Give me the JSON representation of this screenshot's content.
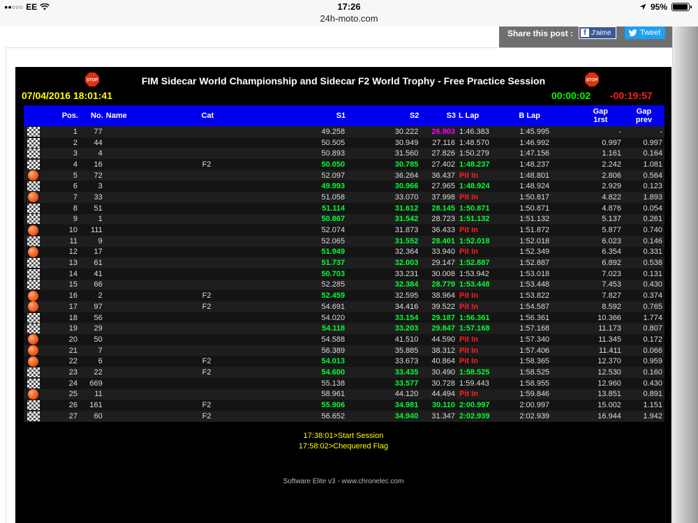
{
  "statusbar": {
    "carrier": "EE",
    "signal": "●●○○○",
    "time": "17:26",
    "url": "24h-moto.com",
    "battery": "95%",
    "battery_level": 0.95
  },
  "share": {
    "label": "Share this post :",
    "fb_label": "J'aime",
    "tw_label": "Tweet"
  },
  "board": {
    "title": "FIM Sidecar World Championship and Sidecar F2 World Trophy - Free Practice Session",
    "datetime": "07/04/2016 18:01:41",
    "elapsed": "00:00:02",
    "remaining": "-00:19:57",
    "headers": {
      "pos": "Pos.",
      "no": "No.",
      "name": "Name",
      "cat": "Cat",
      "s1": "S1",
      "s2": "S2",
      "s3": "S3",
      "llap": "L Lap",
      "blap": "B Lap",
      "gap1": "Gap",
      "gap1b": "1rst",
      "gap2": "Gap",
      "gap2b": "prev"
    },
    "rows": [
      {
        "status": "flag",
        "pos": "1",
        "no": "77",
        "name": "",
        "cat": "",
        "s1": "49.258",
        "s1c": "",
        "s2": "30.222",
        "s2c": "",
        "s3": "26.903",
        "s3c": "magenta",
        "llap": "1:46.383",
        "llapc": "",
        "blap": "1:45.995",
        "gap1": "-",
        "gap2": "-"
      },
      {
        "status": "flag",
        "pos": "2",
        "no": "44",
        "name": "",
        "cat": "",
        "s1": "50.505",
        "s1c": "",
        "s2": "30.949",
        "s2c": "",
        "s3": "27.116",
        "s3c": "",
        "llap": "1:48.570",
        "llapc": "",
        "blap": "1:46.992",
        "gap1": "0.997",
        "gap2": "0.997"
      },
      {
        "status": "flag",
        "pos": "3",
        "no": "4",
        "name": "",
        "cat": "",
        "s1": "50.893",
        "s1c": "",
        "s2": "31.560",
        "s2c": "",
        "s3": "27.826",
        "s3c": "",
        "llap": "1:50.279",
        "llapc": "",
        "blap": "1:47.156",
        "gap1": "1.161",
        "gap2": "0.164"
      },
      {
        "status": "flag",
        "pos": "4",
        "no": "16",
        "name": "",
        "cat": "F2",
        "s1": "50.050",
        "s1c": "green",
        "s2": "30.785",
        "s2c": "green",
        "s3": "27.402",
        "s3c": "",
        "llap": "1:48.237",
        "llapc": "green",
        "blap": "1:48.237",
        "gap1": "2.242",
        "gap2": "1.081"
      },
      {
        "status": "ball",
        "pos": "5",
        "no": "72",
        "name": "",
        "cat": "",
        "s1": "52.097",
        "s1c": "",
        "s2": "36.264",
        "s2c": "",
        "s3": "36.437",
        "s3c": "",
        "llap": "Pit In",
        "llapc": "pitin",
        "blap": "1:48.801",
        "gap1": "2.806",
        "gap2": "0.564"
      },
      {
        "status": "flag",
        "pos": "6",
        "no": "3",
        "name": "",
        "cat": "",
        "s1": "49.993",
        "s1c": "green",
        "s2": "30.966",
        "s2c": "green",
        "s3": "27.965",
        "s3c": "",
        "llap": "1:48.924",
        "llapc": "green",
        "blap": "1:48.924",
        "gap1": "2.929",
        "gap2": "0.123"
      },
      {
        "status": "ball",
        "pos": "7",
        "no": "33",
        "name": "",
        "cat": "",
        "s1": "51.058",
        "s1c": "",
        "s2": "33.070",
        "s2c": "",
        "s3": "37.998",
        "s3c": "",
        "llap": "Pit In",
        "llapc": "pitin",
        "blap": "1:50.817",
        "gap1": "4.822",
        "gap2": "1.893"
      },
      {
        "status": "flag",
        "pos": "8",
        "no": "51",
        "name": "",
        "cat": "",
        "s1": "51.114",
        "s1c": "green",
        "s2": "31.612",
        "s2c": "green",
        "s3": "28.145",
        "s3c": "green",
        "llap": "1:50.871",
        "llapc": "green",
        "blap": "1:50.871",
        "gap1": "4.876",
        "gap2": "0.054"
      },
      {
        "status": "flag",
        "pos": "9",
        "no": "1",
        "name": "",
        "cat": "",
        "s1": "50.867",
        "s1c": "green",
        "s2": "31.542",
        "s2c": "green",
        "s3": "28.723",
        "s3c": "",
        "llap": "1:51.132",
        "llapc": "green",
        "blap": "1:51.132",
        "gap1": "5.137",
        "gap2": "0.261"
      },
      {
        "status": "ball",
        "pos": "10",
        "no": "111",
        "name": "",
        "cat": "",
        "s1": "52.074",
        "s1c": "",
        "s2": "31.873",
        "s2c": "",
        "s3": "36.433",
        "s3c": "",
        "llap": "Pit In",
        "llapc": "pitin",
        "blap": "1:51.872",
        "gap1": "5.877",
        "gap2": "0.740"
      },
      {
        "status": "flag",
        "pos": "11",
        "no": "9",
        "name": "",
        "cat": "",
        "s1": "52.065",
        "s1c": "",
        "s2": "31.552",
        "s2c": "green",
        "s3": "28.401",
        "s3c": "green",
        "llap": "1:52.018",
        "llapc": "green",
        "blap": "1:52.018",
        "gap1": "6.023",
        "gap2": "0.146"
      },
      {
        "status": "ball",
        "pos": "12",
        "no": "17",
        "name": "",
        "cat": "",
        "s1": "51.949",
        "s1c": "green",
        "s2": "32.364",
        "s2c": "",
        "s3": "33.940",
        "s3c": "",
        "llap": "Pit In",
        "llapc": "pitin",
        "blap": "1:52.349",
        "gap1": "6.354",
        "gap2": "0.331"
      },
      {
        "status": "flag",
        "pos": "13",
        "no": "61",
        "name": "",
        "cat": "",
        "s1": "51.737",
        "s1c": "green",
        "s2": "32.003",
        "s2c": "green",
        "s3": "29.147",
        "s3c": "",
        "llap": "1:52.887",
        "llapc": "green",
        "blap": "1:52.887",
        "gap1": "6.892",
        "gap2": "0.538"
      },
      {
        "status": "flag",
        "pos": "14",
        "no": "41",
        "name": "",
        "cat": "",
        "s1": "50.703",
        "s1c": "green",
        "s2": "33.231",
        "s2c": "",
        "s3": "30.008",
        "s3c": "",
        "llap": "1:53.942",
        "llapc": "",
        "blap": "1:53.018",
        "gap1": "7.023",
        "gap2": "0.131"
      },
      {
        "status": "flag",
        "pos": "15",
        "no": "66",
        "name": "",
        "cat": "",
        "s1": "52.285",
        "s1c": "",
        "s2": "32.384",
        "s2c": "green",
        "s3": "28.779",
        "s3c": "green",
        "llap": "1:53.448",
        "llapc": "green",
        "blap": "1:53.448",
        "gap1": "7.453",
        "gap2": "0.430"
      },
      {
        "status": "ball",
        "pos": "16",
        "no": "2",
        "name": "",
        "cat": "F2",
        "s1": "52.459",
        "s1c": "green",
        "s2": "32.595",
        "s2c": "",
        "s3": "38.964",
        "s3c": "",
        "llap": "Pit In",
        "llapc": "pitin",
        "blap": "1:53.822",
        "gap1": "7.827",
        "gap2": "0.374"
      },
      {
        "status": "ball",
        "pos": "17",
        "no": "97",
        "name": "",
        "cat": "F2",
        "s1": "54.691",
        "s1c": "",
        "s2": "34.416",
        "s2c": "",
        "s3": "39.522",
        "s3c": "",
        "llap": "Pit In",
        "llapc": "pitin",
        "blap": "1:54.587",
        "gap1": "8.592",
        "gap2": "0.765"
      },
      {
        "status": "flag",
        "pos": "18",
        "no": "56",
        "name": "",
        "cat": "",
        "s1": "54.020",
        "s1c": "",
        "s2": "33.154",
        "s2c": "green",
        "s3": "29.187",
        "s3c": "green",
        "llap": "1:56.361",
        "llapc": "green",
        "blap": "1:56.361",
        "gap1": "10.366",
        "gap2": "1.774"
      },
      {
        "status": "flag",
        "pos": "19",
        "no": "29",
        "name": "",
        "cat": "",
        "s1": "54.118",
        "s1c": "green",
        "s2": "33.203",
        "s2c": "green",
        "s3": "29.847",
        "s3c": "green",
        "llap": "1:57.168",
        "llapc": "green",
        "blap": "1:57.168",
        "gap1": "11.173",
        "gap2": "0.807"
      },
      {
        "status": "ball",
        "pos": "20",
        "no": "50",
        "name": "",
        "cat": "",
        "s1": "54.588",
        "s1c": "",
        "s2": "41.510",
        "s2c": "",
        "s3": "44.590",
        "s3c": "",
        "llap": "Pit In",
        "llapc": "pitin",
        "blap": "1:57.340",
        "gap1": "11.345",
        "gap2": "0.172"
      },
      {
        "status": "ball",
        "pos": "21",
        "no": "7",
        "name": "",
        "cat": "",
        "s1": "56.389",
        "s1c": "",
        "s2": "35.885",
        "s2c": "",
        "s3": "38.312",
        "s3c": "",
        "llap": "Pit In",
        "llapc": "pitin",
        "blap": "1:57.406",
        "gap1": "11.411",
        "gap2": "0.066"
      },
      {
        "status": "ball",
        "pos": "22",
        "no": "6",
        "name": "",
        "cat": "F2",
        "s1": "54.013",
        "s1c": "green",
        "s2": "33.673",
        "s2c": "",
        "s3": "40.864",
        "s3c": "",
        "llap": "Pit In",
        "llapc": "pitin",
        "blap": "1:58.365",
        "gap1": "12.370",
        "gap2": "0.959"
      },
      {
        "status": "flag",
        "pos": "23",
        "no": "22",
        "name": "",
        "cat": "F2",
        "s1": "54.600",
        "s1c": "green",
        "s2": "33.435",
        "s2c": "green",
        "s3": "30.490",
        "s3c": "",
        "llap": "1:58.525",
        "llapc": "green",
        "blap": "1:58.525",
        "gap1": "12.530",
        "gap2": "0.160"
      },
      {
        "status": "flag",
        "pos": "24",
        "no": "669",
        "name": "",
        "cat": "",
        "s1": "55.138",
        "s1c": "",
        "s2": "33.577",
        "s2c": "green",
        "s3": "30.728",
        "s3c": "",
        "llap": "1:59.443",
        "llapc": "",
        "blap": "1:58.955",
        "gap1": "12.960",
        "gap2": "0.430"
      },
      {
        "status": "ball",
        "pos": "25",
        "no": "11",
        "name": "",
        "cat": "",
        "s1": "58.961",
        "s1c": "",
        "s2": "44.120",
        "s2c": "",
        "s3": "44.494",
        "s3c": "",
        "llap": "Pit In",
        "llapc": "pitin",
        "blap": "1:59.846",
        "gap1": "13.851",
        "gap2": "0.891"
      },
      {
        "status": "flag",
        "pos": "26",
        "no": "161",
        "name": "",
        "cat": "F2",
        "s1": "55.906",
        "s1c": "green",
        "s2": "34.981",
        "s2c": "green",
        "s3": "30.110",
        "s3c": "green",
        "llap": "2:00.997",
        "llapc": "green",
        "blap": "2:00.997",
        "gap1": "15.002",
        "gap2": "1.151"
      },
      {
        "status": "flag",
        "pos": "27",
        "no": "60",
        "name": "",
        "cat": "F2",
        "s1": "56.652",
        "s1c": "",
        "s2": "34.940",
        "s2c": "green",
        "s3": "31.347",
        "s3c": "",
        "llap": "2:02.939",
        "llapc": "green",
        "blap": "2:02.939",
        "gap1": "16.944",
        "gap2": "1.942"
      }
    ],
    "events": [
      "17:38:01>Start Session",
      "17:58:02>Chequered Flag"
    ],
    "footer": "Software Elite v3 - www.chronelec.com"
  },
  "colors": {
    "header_blue": "#0000ee",
    "best_green": "#00ff33",
    "overall_best_magenta": "#ff00ff",
    "pit_red": "#ff2020",
    "date_yellow": "#ffff00"
  }
}
